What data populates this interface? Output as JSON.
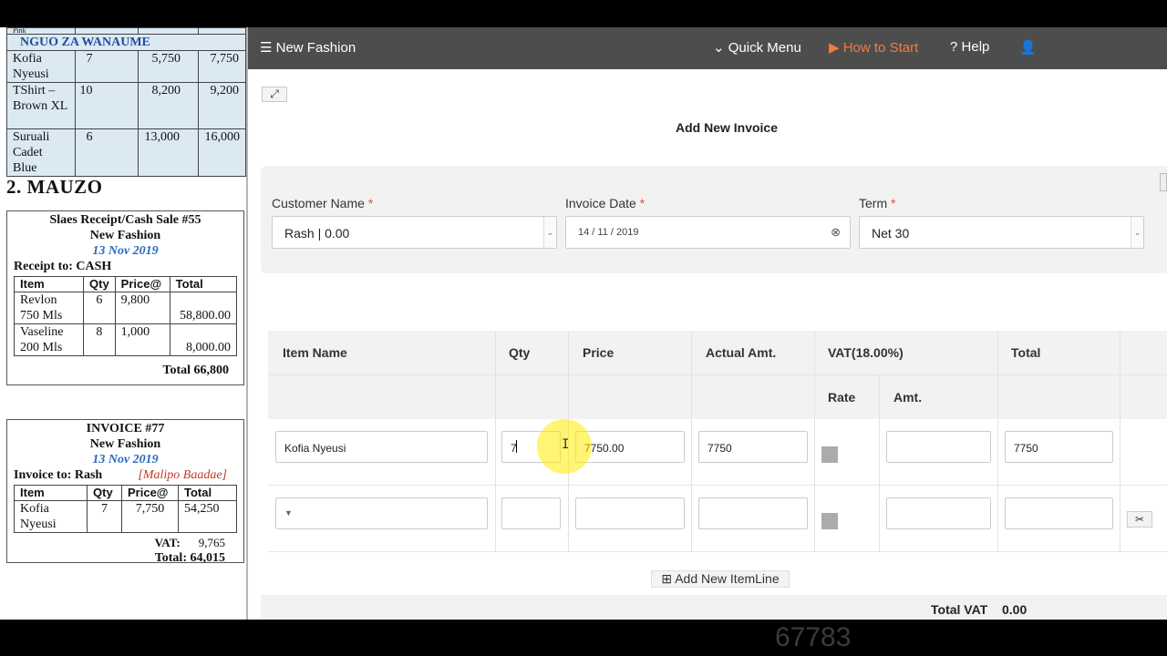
{
  "document": {
    "stock_table": {
      "cut_label": "Pink",
      "category": "NGUO ZA WANAUME",
      "rows": [
        {
          "item": "Kofia Nyeusi",
          "qty": "7",
          "buy": "5,750",
          "sell": "7,750"
        },
        {
          "item": "TShirt – Brown XL",
          "qty": "10",
          "buy": "8,200",
          "sell": "9,200"
        },
        {
          "item": "Suruali Cadet Blue",
          "qty": "6",
          "buy": "13,000",
          "sell": "16,000"
        }
      ]
    },
    "section_title": "2. MAUZO",
    "receipt": {
      "title": "Slaes Receipt/Cash Sale #55",
      "company": "New Fashion",
      "date": "13 Nov 2019",
      "to": "Receipt to: CASH",
      "headers": [
        "Item",
        "Qty",
        "Price@",
        "Total"
      ],
      "rows": [
        {
          "item": "Revlon 750 Mls",
          "qty": "6",
          "price": "9,800",
          "total": "58,800.00"
        },
        {
          "item": "Vaseline 200 Mls",
          "qty": "8",
          "price": "1,000",
          "total": "8,000.00"
        }
      ],
      "total": "Total 66,800"
    },
    "invoice": {
      "title": "INVOICE #77",
      "company": "New Fashion",
      "date": "13 Nov 2019",
      "to": "Invoice to: Rash",
      "terms": "[Malipo Baadae]",
      "headers": [
        "Item",
        "Qty",
        "Price@",
        "Total"
      ],
      "rows": [
        {
          "item": "Kofia Nyeusi",
          "qty": "7",
          "price": "7,750",
          "total": "54,250"
        }
      ],
      "vat_label": "VAT:",
      "vat_value": "9,765",
      "total": "Total: 64,015"
    }
  },
  "topbar": {
    "brand": "New Fashion",
    "quick_menu": "Quick Menu",
    "how_to_start": "How to Start",
    "help": "Help"
  },
  "form": {
    "title": "Add New Invoice",
    "customer_label": "Customer Name",
    "customer_value": "Rash | 0.00",
    "date_label": "Invoice Date",
    "date_value": "14 / 11 / 2019",
    "term_label": "Term",
    "term_value": "Net 30",
    "required_mark": "*"
  },
  "grid": {
    "headers": {
      "item": "Item Name",
      "qty": "Qty",
      "price": "Price",
      "actual": "Actual Amt.",
      "vat": "VAT(18.00%)",
      "total": "Total",
      "rate": "Rate",
      "amt": "Amt."
    },
    "row1": {
      "item": "Kofia Nyeusi",
      "qty": "7",
      "price": "7750.00",
      "actual": "7750",
      "vat_amt": "",
      "total": "7750"
    },
    "row2": {
      "item": "",
      "qty": "",
      "price": "",
      "actual": "",
      "vat_amt": "",
      "total": ""
    },
    "add_line": "Add New ItemLine",
    "total_vat_label": "Total VAT",
    "total_vat_value": "0.00"
  },
  "watermark": "67783",
  "colors": {
    "topbar": "#4d4d4d",
    "accent": "#f47b3b",
    "required": "#e74c3c",
    "doc_date": "#2a6ab8",
    "stock_bg": "#dbe9f3"
  }
}
